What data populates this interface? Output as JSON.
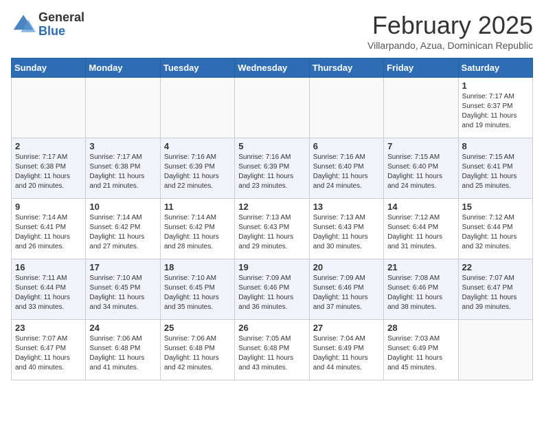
{
  "header": {
    "logo_general": "General",
    "logo_blue": "Blue",
    "month_title": "February 2025",
    "subtitle": "Villarpando, Azua, Dominican Republic"
  },
  "weekdays": [
    "Sunday",
    "Monday",
    "Tuesday",
    "Wednesday",
    "Thursday",
    "Friday",
    "Saturday"
  ],
  "weeks": [
    [
      {
        "day": "",
        "info": ""
      },
      {
        "day": "",
        "info": ""
      },
      {
        "day": "",
        "info": ""
      },
      {
        "day": "",
        "info": ""
      },
      {
        "day": "",
        "info": ""
      },
      {
        "day": "",
        "info": ""
      },
      {
        "day": "1",
        "info": "Sunrise: 7:17 AM\nSunset: 6:37 PM\nDaylight: 11 hours and 19 minutes."
      }
    ],
    [
      {
        "day": "2",
        "info": "Sunrise: 7:17 AM\nSunset: 6:38 PM\nDaylight: 11 hours and 20 minutes."
      },
      {
        "day": "3",
        "info": "Sunrise: 7:17 AM\nSunset: 6:38 PM\nDaylight: 11 hours and 21 minutes."
      },
      {
        "day": "4",
        "info": "Sunrise: 7:16 AM\nSunset: 6:39 PM\nDaylight: 11 hours and 22 minutes."
      },
      {
        "day": "5",
        "info": "Sunrise: 7:16 AM\nSunset: 6:39 PM\nDaylight: 11 hours and 23 minutes."
      },
      {
        "day": "6",
        "info": "Sunrise: 7:16 AM\nSunset: 6:40 PM\nDaylight: 11 hours and 24 minutes."
      },
      {
        "day": "7",
        "info": "Sunrise: 7:15 AM\nSunset: 6:40 PM\nDaylight: 11 hours and 24 minutes."
      },
      {
        "day": "8",
        "info": "Sunrise: 7:15 AM\nSunset: 6:41 PM\nDaylight: 11 hours and 25 minutes."
      }
    ],
    [
      {
        "day": "9",
        "info": "Sunrise: 7:14 AM\nSunset: 6:41 PM\nDaylight: 11 hours and 26 minutes."
      },
      {
        "day": "10",
        "info": "Sunrise: 7:14 AM\nSunset: 6:42 PM\nDaylight: 11 hours and 27 minutes."
      },
      {
        "day": "11",
        "info": "Sunrise: 7:14 AM\nSunset: 6:42 PM\nDaylight: 11 hours and 28 minutes."
      },
      {
        "day": "12",
        "info": "Sunrise: 7:13 AM\nSunset: 6:43 PM\nDaylight: 11 hours and 29 minutes."
      },
      {
        "day": "13",
        "info": "Sunrise: 7:13 AM\nSunset: 6:43 PM\nDaylight: 11 hours and 30 minutes."
      },
      {
        "day": "14",
        "info": "Sunrise: 7:12 AM\nSunset: 6:44 PM\nDaylight: 11 hours and 31 minutes."
      },
      {
        "day": "15",
        "info": "Sunrise: 7:12 AM\nSunset: 6:44 PM\nDaylight: 11 hours and 32 minutes."
      }
    ],
    [
      {
        "day": "16",
        "info": "Sunrise: 7:11 AM\nSunset: 6:44 PM\nDaylight: 11 hours and 33 minutes."
      },
      {
        "day": "17",
        "info": "Sunrise: 7:10 AM\nSunset: 6:45 PM\nDaylight: 11 hours and 34 minutes."
      },
      {
        "day": "18",
        "info": "Sunrise: 7:10 AM\nSunset: 6:45 PM\nDaylight: 11 hours and 35 minutes."
      },
      {
        "day": "19",
        "info": "Sunrise: 7:09 AM\nSunset: 6:46 PM\nDaylight: 11 hours and 36 minutes."
      },
      {
        "day": "20",
        "info": "Sunrise: 7:09 AM\nSunset: 6:46 PM\nDaylight: 11 hours and 37 minutes."
      },
      {
        "day": "21",
        "info": "Sunrise: 7:08 AM\nSunset: 6:46 PM\nDaylight: 11 hours and 38 minutes."
      },
      {
        "day": "22",
        "info": "Sunrise: 7:07 AM\nSunset: 6:47 PM\nDaylight: 11 hours and 39 minutes."
      }
    ],
    [
      {
        "day": "23",
        "info": "Sunrise: 7:07 AM\nSunset: 6:47 PM\nDaylight: 11 hours and 40 minutes."
      },
      {
        "day": "24",
        "info": "Sunrise: 7:06 AM\nSunset: 6:48 PM\nDaylight: 11 hours and 41 minutes."
      },
      {
        "day": "25",
        "info": "Sunrise: 7:06 AM\nSunset: 6:48 PM\nDaylight: 11 hours and 42 minutes."
      },
      {
        "day": "26",
        "info": "Sunrise: 7:05 AM\nSunset: 6:48 PM\nDaylight: 11 hours and 43 minutes."
      },
      {
        "day": "27",
        "info": "Sunrise: 7:04 AM\nSunset: 6:49 PM\nDaylight: 11 hours and 44 minutes."
      },
      {
        "day": "28",
        "info": "Sunrise: 7:03 AM\nSunset: 6:49 PM\nDaylight: 11 hours and 45 minutes."
      },
      {
        "day": "",
        "info": ""
      }
    ]
  ]
}
